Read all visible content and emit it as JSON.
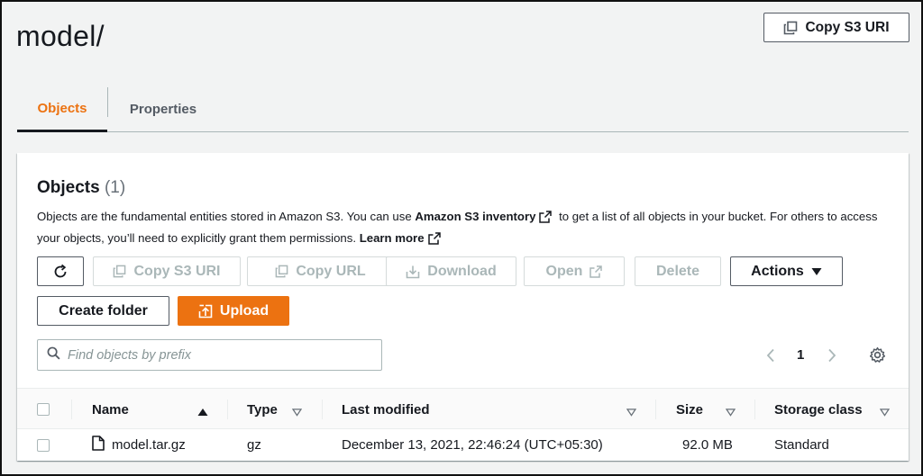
{
  "header": {
    "title": "model/",
    "copy_s3_uri_label": "Copy S3 URI"
  },
  "tabs": [
    {
      "label": "Objects",
      "active": true
    },
    {
      "label": "Properties",
      "active": false
    }
  ],
  "objects_panel": {
    "title": "Objects",
    "count": "(1)",
    "description": {
      "part1": "Objects are the fundamental entities stored in Amazon S3. You can use ",
      "inventory_link": "Amazon S3 inventory",
      "part2": " to get a list of all objects in your bucket. For others to access your objects, you’ll need to explicitly grant them permissions. ",
      "learn_more": "Learn more"
    },
    "toolbar": {
      "copy_s3_uri": "Copy S3 URI",
      "copy_url": "Copy URL",
      "download": "Download",
      "open": "Open",
      "delete": "Delete",
      "actions": "Actions",
      "create_folder": "Create folder",
      "upload": "Upload"
    },
    "search": {
      "placeholder": "Find objects by prefix",
      "value": ""
    },
    "pagination": {
      "current_page": "1"
    },
    "table": {
      "columns": [
        "Name",
        "Type",
        "Last modified",
        "Size",
        "Storage class"
      ],
      "rows": [
        {
          "name": "model.tar.gz",
          "type": "gz",
          "last_modified": "December 13, 2021, 22:46:24 (UTC+05:30)",
          "size": "92.0 MB",
          "storage_class": "Standard"
        }
      ]
    }
  },
  "colors": {
    "accent": "#ec7211",
    "text": "#16191f",
    "muted": "#545b64",
    "disabled": "#aab7b8",
    "background": "#f2f3f3"
  },
  "icons": [
    "copy-icon",
    "refresh-icon",
    "download-icon",
    "external-link-icon",
    "caret-down-icon",
    "upload-icon",
    "search-icon",
    "chevron-left-icon",
    "chevron-right-icon",
    "settings-icon",
    "sort-ascending-icon",
    "sort-icon",
    "file-icon"
  ]
}
